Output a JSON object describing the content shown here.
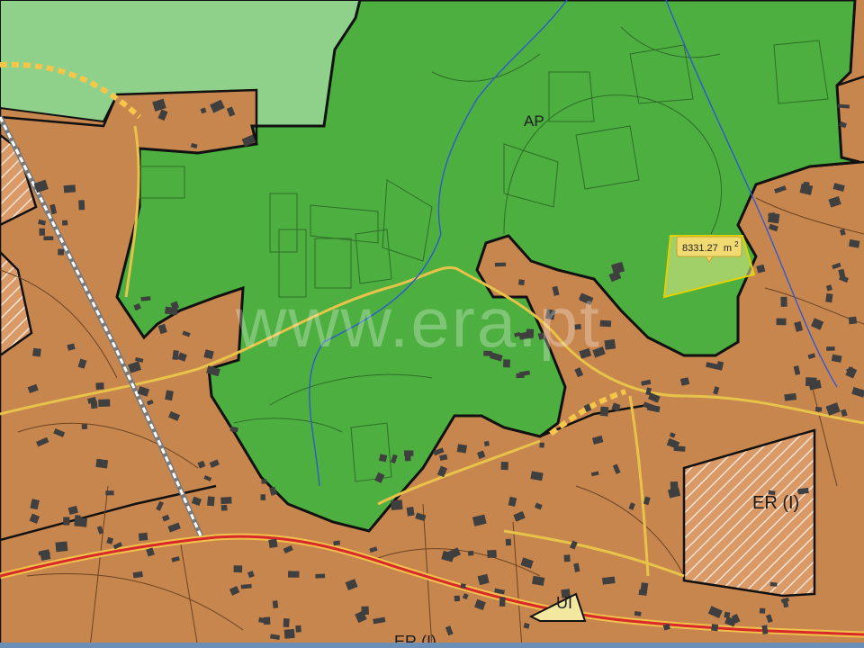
{
  "map": {
    "watermark": "www.era.pt",
    "labels": {
      "ap": "AP",
      "er": "ER (I)",
      "ul": "UI",
      "er_bottom": "ER (I)"
    },
    "parcel_area": {
      "value": "8331.27",
      "unit": "m",
      "exponent": "2"
    }
  },
  "colors": {
    "urban": "#c8864f",
    "forest": "#4caf3f",
    "forest_light": "#8fd08a",
    "zone_border": "#111111",
    "road_main": "#d8282a",
    "road_secondary": "#e8c34a",
    "dashed_border": "#f4c64a",
    "water": "#2b55d6",
    "building": "#3f3f3f",
    "parcel_fill": "#e7ea8b",
    "parcel_stroke": "#e3d100",
    "badge_fill": "#f2da72"
  }
}
